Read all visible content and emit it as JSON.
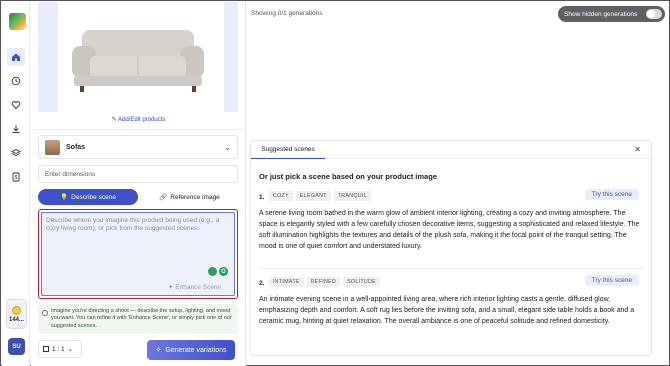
{
  "rail": {
    "items": [
      {
        "icon": "home-icon",
        "active": true
      },
      {
        "icon": "clock-icon",
        "active": false
      },
      {
        "icon": "heart-icon",
        "active": false
      },
      {
        "icon": "download-icon",
        "active": false
      },
      {
        "icon": "layers-icon",
        "active": false
      },
      {
        "icon": "dollar-icon",
        "active": false
      }
    ],
    "credits": "144...",
    "avatar": "SU"
  },
  "left": {
    "edit_products": "Add/Edit products",
    "product_label": "Sofas",
    "dimensions_placeholder": "Enter dimensions",
    "tab_describe": "Describe scene",
    "tab_reference": "Reference image",
    "description_placeholder": "Describe where you imagine this product being used (e.g., a cozy living room), or pick from the suggested scenes.",
    "enhance_label": "Enhance Scene",
    "tip": "Imagine you're directing a shoot — describe the setup, lighting, and mood you want. You can refine it with 'Enhance Scene', or simply pick one of our suggested scenes.",
    "aspect_ratio": "1 : 1",
    "generate_label": "Generate variations"
  },
  "main": {
    "showing": "Showing 0/1 generations",
    "hidden_toggle": "Show hidden generations"
  },
  "suggestions": {
    "tab": "Suggested scenes",
    "title": "Or just pick a scene based on your product image",
    "try_label": "Try this scene",
    "scenes": [
      {
        "num": "1.",
        "tags": [
          "COZY",
          "ELEGANT",
          "TRANQUIL"
        ],
        "text": "A serene living room bathed in the warm glow of ambient interior lighting, creating a cozy and inviting atmosphere. The space is elegantly styled with a few carefully chosen decorative items, suggesting a sophisticated and relaxed lifestyle. The soft illumination highlights the textures and details of the plush sofa, making it the focal point of the tranquil setting. The mood is one of quiet comfort and understated luxury."
      },
      {
        "num": "2.",
        "tags": [
          "INTIMATE",
          "REFINED",
          "SOLITUDE"
        ],
        "text": "An intimate evening scene in a well-appointed living area, where rich interior lighting casts a gentle, diffused glow, emphasizing depth and comfort. A soft rug lies before the inviting sofa, and a small, elegant side table holds a book and a ceramic mug, hinting at quiet relaxation. The overall ambiance is one of peaceful solitude and refined domesticity."
      }
    ]
  },
  "colors": {
    "accent": "#3f51c9",
    "highlight_border": "#b01f3a"
  }
}
